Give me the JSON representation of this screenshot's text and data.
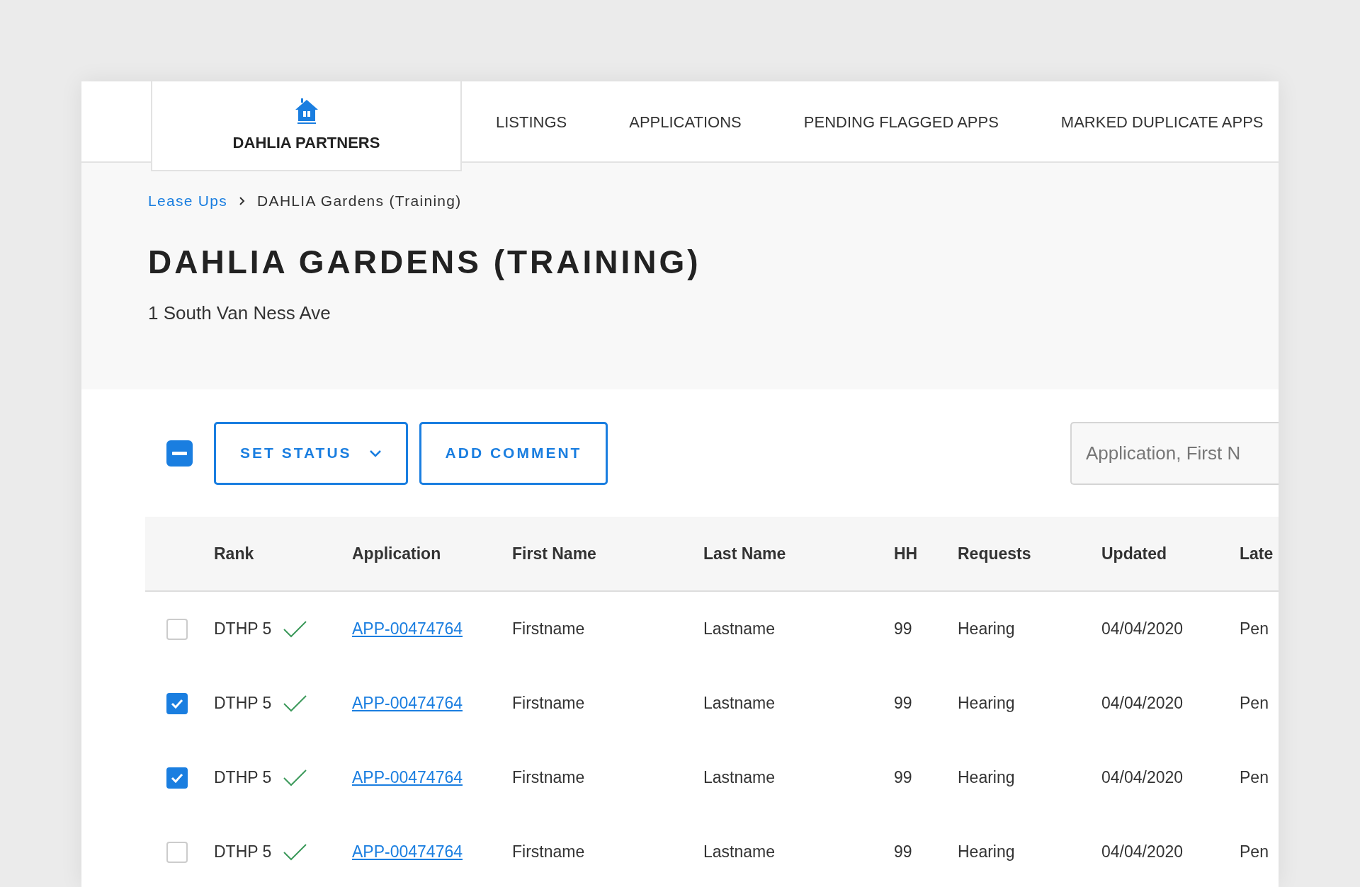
{
  "brand": {
    "name": "DAHLIA PARTNERS"
  },
  "nav": [
    {
      "label": "LISTINGS"
    },
    {
      "label": "APPLICATIONS"
    },
    {
      "label": "PENDING FLAGGED APPS"
    },
    {
      "label": "MARKED DUPLICATE APPS"
    }
  ],
  "breadcrumb": [
    {
      "label": "Lease Ups",
      "kind": "link"
    },
    {
      "label": "DAHLIA Gardens (Training)",
      "kind": "current"
    }
  ],
  "page": {
    "title": "DAHLIA GARDENS (TRAINING)",
    "address": "1 South Van Ness Ave"
  },
  "toolbar": {
    "select_all": {
      "indeterminate": true
    },
    "buttons": [
      {
        "label": "SET STATUS",
        "kind": "dropdown"
      },
      {
        "label": "ADD COMMENT",
        "kind": "plain"
      }
    ],
    "search": {
      "placeholder": "Application, First N"
    }
  },
  "table": {
    "columns": [
      "Rank",
      "Application",
      "First Name",
      "Last Name",
      "HH",
      "Requests",
      "Updated",
      "Late"
    ],
    "rows": [
      {
        "checked": false,
        "rank": "DTHP 5",
        "verified": true,
        "application": "APP-00474764",
        "first_name": "Firstname",
        "last_name": "Lastname",
        "hh": "99",
        "requests": "Hearing",
        "updated": "04/04/2020",
        "column_8": "Pen"
      },
      {
        "checked": true,
        "rank": "DTHP 5",
        "verified": true,
        "application": "APP-00474764",
        "first_name": "Firstname",
        "last_name": "Lastname",
        "hh": "99",
        "requests": "Hearing",
        "updated": "04/04/2020",
        "column_8": "Pen"
      },
      {
        "checked": true,
        "rank": "DTHP 5",
        "verified": true,
        "application": "APP-00474764",
        "first_name": "Firstname",
        "last_name": "Lastname",
        "hh": "99",
        "requests": "Hearing",
        "updated": "04/04/2020",
        "column_8": "Pen"
      },
      {
        "checked": false,
        "rank": "DTHP 5",
        "verified": true,
        "application": "APP-00474764",
        "first_name": "Firstname",
        "last_name": "Lastname",
        "hh": "99",
        "requests": "Hearing",
        "updated": "04/04/2020",
        "column_8": "Pen"
      }
    ]
  }
}
